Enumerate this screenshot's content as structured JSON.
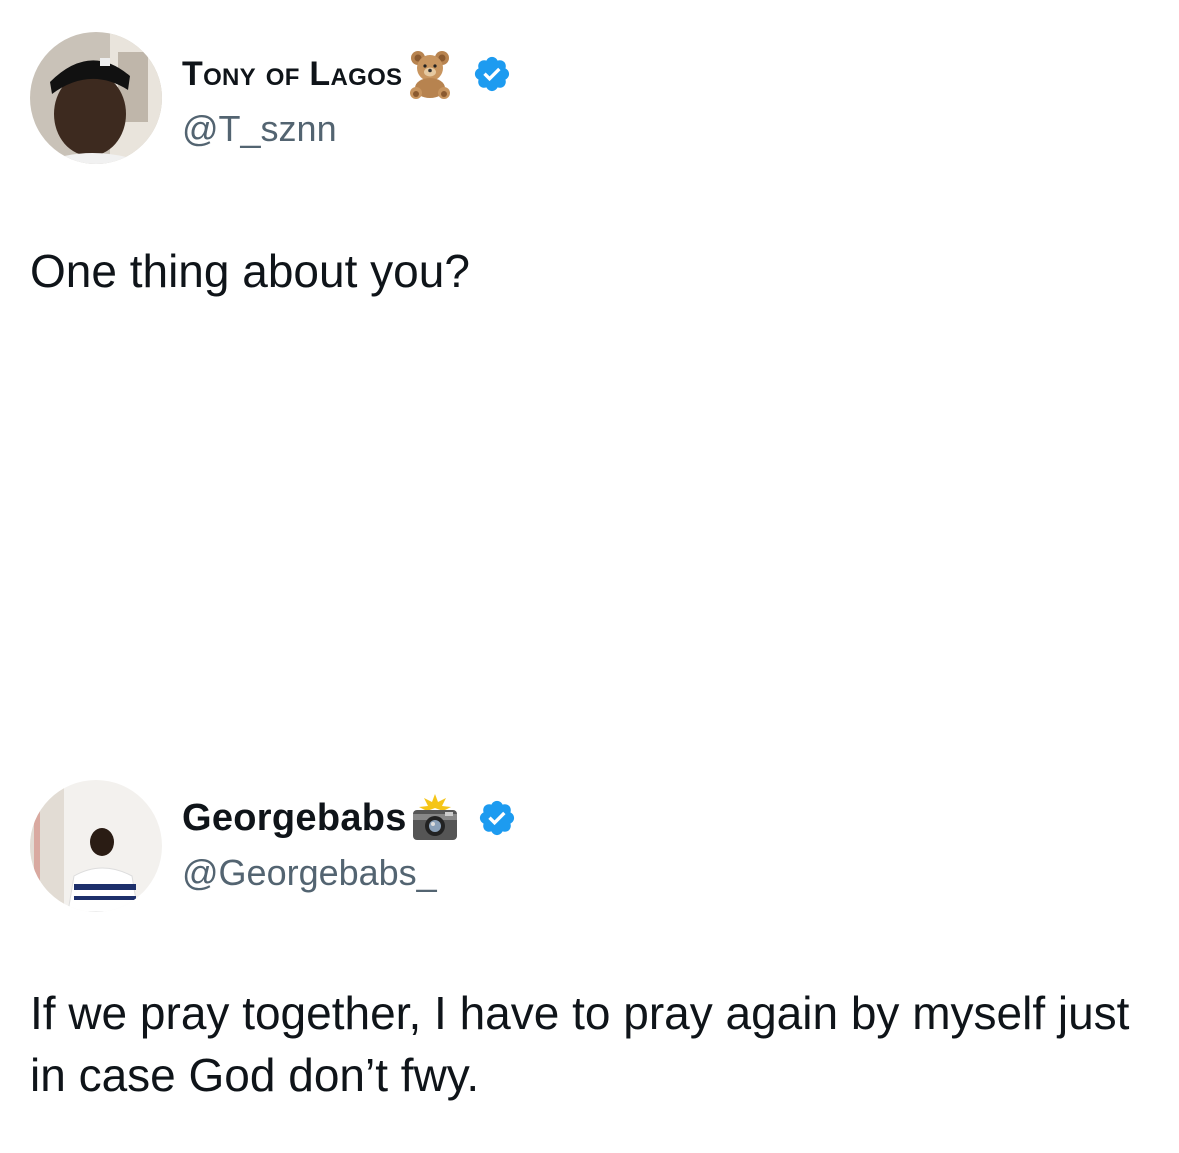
{
  "tweets": [
    {
      "display_name": "Tony of Lagos",
      "name_emoji": "teddy-bear-emoji",
      "verified": true,
      "handle": "@T_sznn",
      "text": "One thing about you?"
    },
    {
      "display_name": "Georgebabs",
      "name_emoji": "camera-with-flash-emoji",
      "verified": true,
      "handle": "@Georgebabs_",
      "text": "If we pray together, I have to pray again by myself just in case God don’t fwy."
    }
  ],
  "colors": {
    "text": "#0f1419",
    "handle": "#536471",
    "verified_badge": "#1d9bf0",
    "background": "#ffffff"
  }
}
